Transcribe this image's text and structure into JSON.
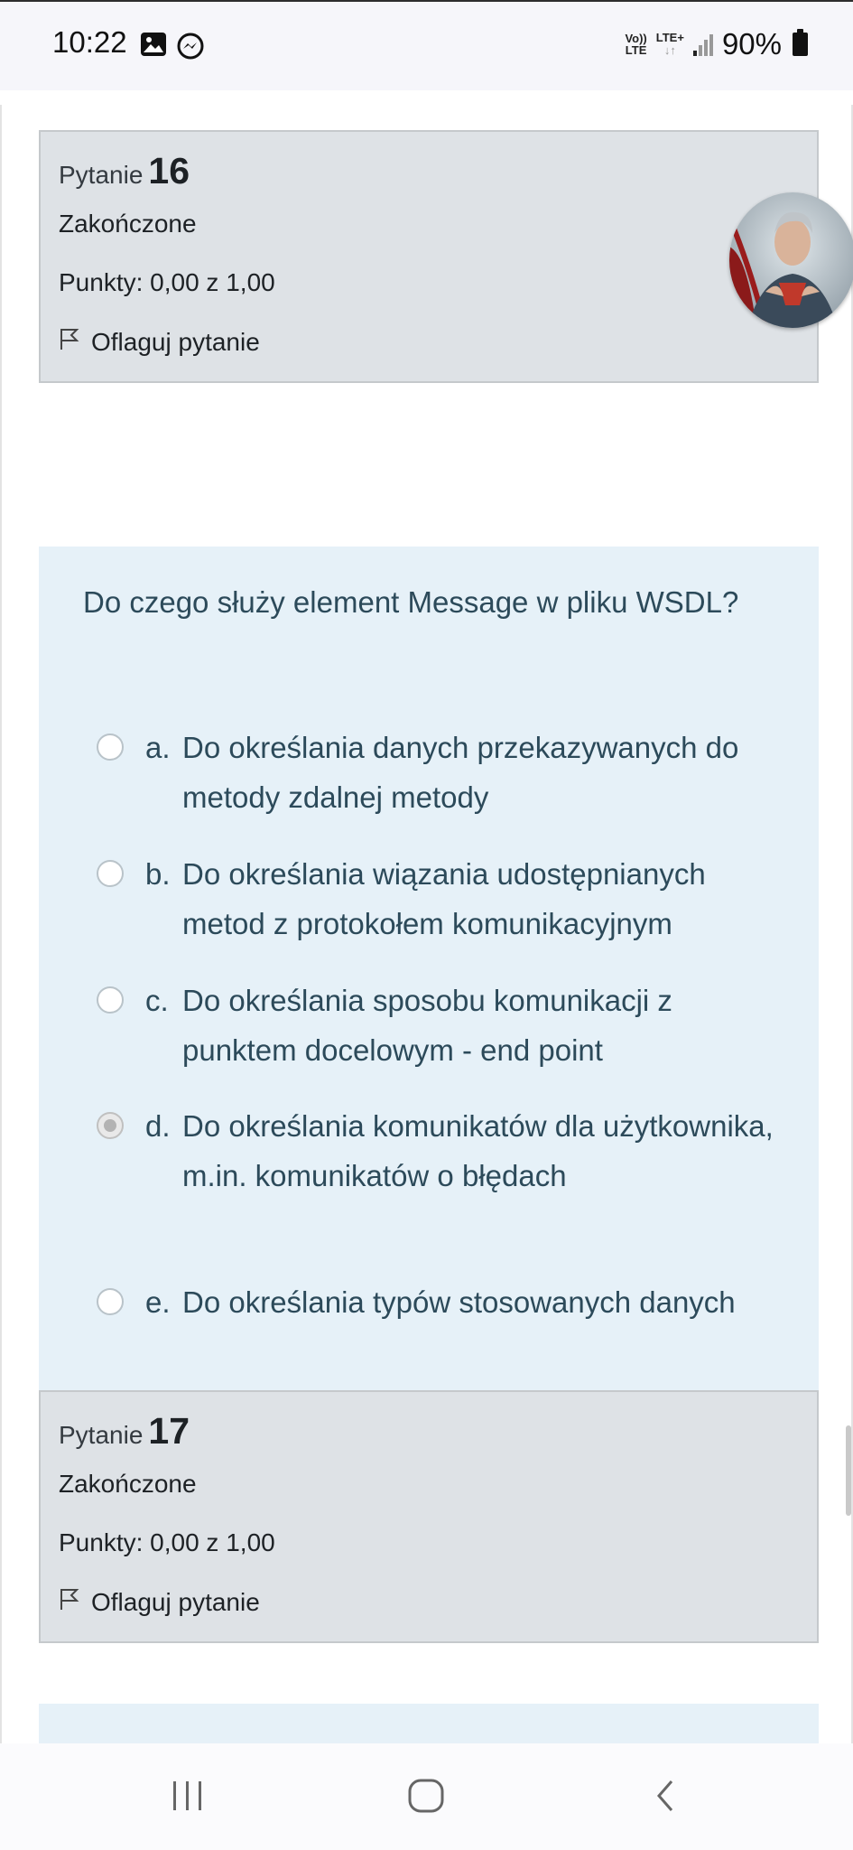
{
  "status_bar": {
    "time": "10:22",
    "left_icons": [
      "gallery-icon",
      "messenger-icon"
    ],
    "network_volte": "Vo))",
    "network_lte": "LTE",
    "network_lteplus": "LTE+",
    "battery": "90%"
  },
  "question16": {
    "label": "Pytanie",
    "number": "16",
    "state": "Zakończone",
    "grade": "Punkty: 0,00 z 1,00",
    "flag_label": "Oflaguj pytanie",
    "text": "Do czego służy element Message w pliku WSDL?",
    "answers": [
      {
        "letter": "a.",
        "text": "Do określania danych przekazywanych do metody zdalnej metody",
        "selected": false
      },
      {
        "letter": "b.",
        "text": "Do określania wiązania udostępnianych metod z protokołem komunikacyjnym",
        "selected": false
      },
      {
        "letter": "c.",
        "text": "Do określania sposobu komunikacji z punktem docelowym - end point",
        "selected": false
      },
      {
        "letter": "d.",
        "text": "Do określania komunikatów dla użytkownika, m.in. komunikatów o błędach",
        "selected": true
      },
      {
        "letter": "e.",
        "text": "Do określania typów stosowanych danych",
        "selected": false
      }
    ]
  },
  "question17": {
    "label": "Pytanie",
    "number": "17",
    "state": "Zakończone",
    "grade": "Punkty: 0,00 z 1,00",
    "flag_label": "Oflaguj pytanie"
  },
  "nav_bar": {
    "buttons": [
      "recent-apps-icon",
      "home-icon",
      "back-icon"
    ]
  },
  "colors": {
    "info_bg": "#dee2e6",
    "formulation_bg": "#e6f1f8",
    "question_text": "#2c4a5a"
  }
}
